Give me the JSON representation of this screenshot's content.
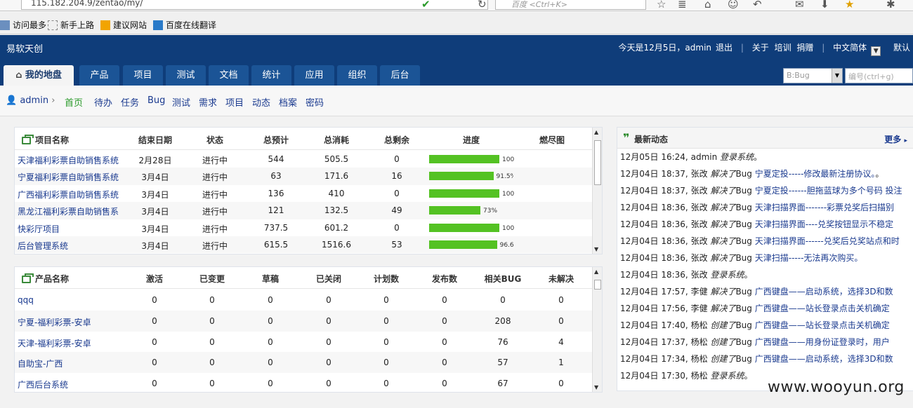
{
  "browser": {
    "url": "115.182.204.9/zentao/my/",
    "search_placeholder": "百度 <Ctrl+K>",
    "bookmarks": [
      "访问最多",
      "新手上路",
      "建议网站",
      "百度在线翻译"
    ]
  },
  "app": {
    "brand": "易软天创",
    "today": "今天是12月5日，admin",
    "logout": "退出",
    "links": [
      "关于",
      "培训",
      "捐赠"
    ],
    "lang": "中文简体",
    "theme": "默认"
  },
  "nav": {
    "tabs": [
      "我的地盘",
      "产品",
      "项目",
      "测试",
      "文档",
      "统计",
      "应用",
      "组织",
      "后台"
    ],
    "search_type": "B:Bug",
    "search_placeholder": "编号(ctrl+g)"
  },
  "subnav": {
    "user": "admin",
    "items": [
      "首页",
      "待办",
      "任务",
      "Bug",
      "测试",
      "需求",
      "项目",
      "动态",
      "档案",
      "密码"
    ]
  },
  "projects": {
    "headers": [
      "项目名称",
      "结束日期",
      "状态",
      "总预计",
      "总消耗",
      "总剩余",
      "进度",
      "燃尽图"
    ],
    "rows": [
      {
        "name": "天津福利彩票自助销售系统",
        "end": "2月28日",
        "status": "进行中",
        "est": "544",
        "consumed": "505.5",
        "left": "0",
        "progress": 100,
        "plabel": "100"
      },
      {
        "name": "宁夏福利彩票自助销售系统",
        "end": "3月4日",
        "status": "进行中",
        "est": "63",
        "consumed": "171.6",
        "left": "16",
        "progress": 91.5,
        "plabel": "91.5%"
      },
      {
        "name": "广西福利彩票自助销售系统",
        "end": "3月4日",
        "status": "进行中",
        "est": "136",
        "consumed": "410",
        "left": "0",
        "progress": 100,
        "plabel": "100"
      },
      {
        "name": "黑龙江福利彩票自助销售系",
        "end": "3月4日",
        "status": "进行中",
        "est": "121",
        "consumed": "132.5",
        "left": "49",
        "progress": 73,
        "plabel": "73%"
      },
      {
        "name": "快彩厅项目",
        "end": "3月4日",
        "status": "进行中",
        "est": "737.5",
        "consumed": "601.2",
        "left": "0",
        "progress": 100,
        "plabel": "100"
      },
      {
        "name": "后台管理系统",
        "end": "3月4日",
        "status": "进行中",
        "est": "615.5",
        "consumed": "1516.6",
        "left": "53",
        "progress": 96.6,
        "plabel": "96.6"
      }
    ]
  },
  "products": {
    "headers": [
      "产品名称",
      "激活",
      "已变更",
      "草稿",
      "已关闭",
      "计划数",
      "发布数",
      "相关BUG",
      "未解决"
    ],
    "rows": [
      {
        "name": "qqq",
        "vals": [
          "0",
          "0",
          "0",
          "0",
          "0",
          "0",
          "0",
          "0"
        ]
      },
      {
        "name": "宁夏-福利彩票-安卓",
        "vals": [
          "0",
          "0",
          "0",
          "0",
          "0",
          "0",
          "208",
          "0"
        ]
      },
      {
        "name": "天津-福利彩票-安卓",
        "vals": [
          "0",
          "0",
          "0",
          "0",
          "0",
          "0",
          "76",
          "4"
        ]
      },
      {
        "name": "自助宝-广西",
        "vals": [
          "0",
          "0",
          "0",
          "0",
          "0",
          "0",
          "57",
          "1"
        ]
      },
      {
        "name": "广西后台系统",
        "vals": [
          "0",
          "0",
          "0",
          "0",
          "0",
          "0",
          "67",
          "0"
        ]
      }
    ]
  },
  "dynamics": {
    "title": "最新动态",
    "more": "更多",
    "items": [
      {
        "time": "12月05日 16:24,",
        "user": "admin",
        "action": "登录系统",
        "type": "",
        "obj": "",
        "end": "。"
      },
      {
        "time": "12月04日 18:37,",
        "user": "张改",
        "action": "解决了",
        "type": "Bug",
        "obj": "宁夏定投-----修改最新注册协议。",
        "end": "。"
      },
      {
        "time": "12月04日 18:37,",
        "user": "张改",
        "action": "解决了",
        "type": "Bug",
        "obj": "宁夏定投------胆拖蓝球为多个号码 投注",
        "end": ""
      },
      {
        "time": "12月04日 18:36,",
        "user": "张改",
        "action": "解决了",
        "type": "Bug",
        "obj": "天津扫描界面-------彩票兑奖后扫描别",
        "end": ""
      },
      {
        "time": "12月04日 18:36,",
        "user": "张改",
        "action": "解决了",
        "type": "Bug",
        "obj": "天津扫描界面----兑奖按钮显示不稳定",
        "end": ""
      },
      {
        "time": "12月04日 18:36,",
        "user": "张改",
        "action": "解决了",
        "type": "Bug",
        "obj": "天津扫描界面------兑奖后兑奖站点和时",
        "end": ""
      },
      {
        "time": "12月04日 18:36,",
        "user": "张改",
        "action": "解决了",
        "type": "Bug",
        "obj": "天津扫描-----无法再次购买。",
        "end": ""
      },
      {
        "time": "12月04日 18:36,",
        "user": "张改",
        "action": "登录系统",
        "type": "",
        "obj": "",
        "end": "。"
      },
      {
        "time": "12月04日 17:57,",
        "user": "李健",
        "action": "解决了",
        "type": "Bug",
        "obj": "广西键盘——启动系统，选择3D和数",
        "end": ""
      },
      {
        "time": "12月04日 17:56,",
        "user": "李健",
        "action": "解决了",
        "type": "Bug",
        "obj": "广西键盘——站长登录点击关机确定",
        "end": ""
      },
      {
        "time": "12月04日 17:40,",
        "user": "杨松",
        "action": "创建了",
        "type": "Bug",
        "obj": "广西键盘——站长登录点击关机确定",
        "end": ""
      },
      {
        "time": "12月04日 17:37,",
        "user": "杨松",
        "action": "创建了",
        "type": "Bug",
        "obj": "广西键盘——用身份证登录时，用户",
        "end": ""
      },
      {
        "time": "12月04日 17:34,",
        "user": "杨松",
        "action": "创建了",
        "type": "Bug",
        "obj": "广西键盘——启动系统，选择3D和数",
        "end": ""
      },
      {
        "time": "12月04日 17:30,",
        "user": "杨松",
        "action": "登录系统",
        "type": "",
        "obj": "",
        "end": "。"
      }
    ]
  },
  "watermark": "www.wooyun.org"
}
